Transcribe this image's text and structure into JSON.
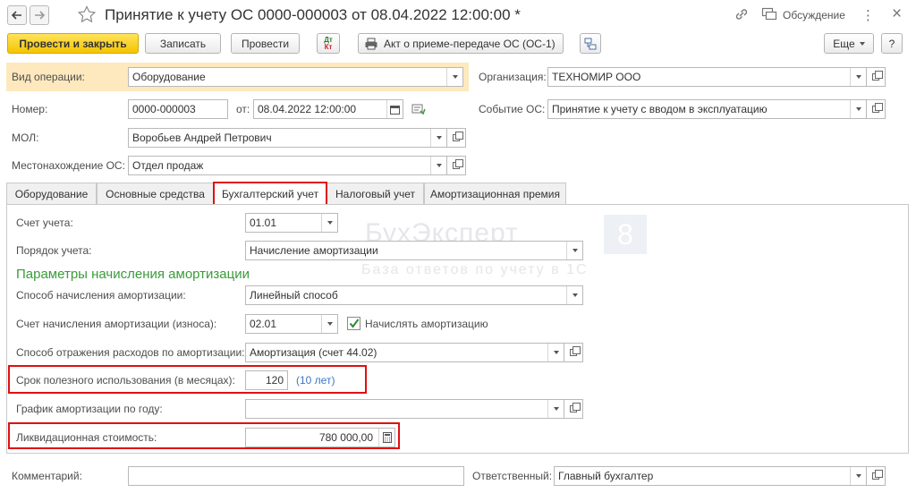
{
  "window": {
    "title": "Принятие к учету ОС 0000-000003 от 08.04.2022 12:00:00 *",
    "discussion_label": "Обсуждение",
    "more_glyph": "⋮",
    "close_glyph": "×"
  },
  "toolbar": {
    "post_close": "Провести и закрыть",
    "save": "Записать",
    "post": "Провести",
    "dt_kt_top": "Дт",
    "dt_kt_bottom": "Кт",
    "act_label": "Акт о приеме-передаче ОС (ОС-1)",
    "more": "Еще",
    "help": "?"
  },
  "header": {
    "operation_type_label": "Вид операции:",
    "operation_type_value": "Оборудование",
    "organization_label": "Организация:",
    "organization_value": "ТЕХНОМИР ООО",
    "number_label": "Номер:",
    "number_value": "0000-000003",
    "date_label": "от:",
    "date_value": "08.04.2022 12:00:00",
    "event_label": "Событие ОС:",
    "event_value": "Принятие к учету с вводом в эксплуатацию",
    "mol_label": "МОЛ:",
    "mol_value": "Воробьев Андрей Петрович",
    "location_label": "Местонахождение ОС:",
    "location_value": "Отдел продаж"
  },
  "tabs": [
    {
      "label": "Оборудование"
    },
    {
      "label": "Основные средства"
    },
    {
      "label": "Бухгалтерский учет"
    },
    {
      "label": "Налоговый учет"
    },
    {
      "label": "Амортизационная премия"
    }
  ],
  "accounting": {
    "account_label": "Счет учета:",
    "account_value": "01.01",
    "order_label": "Порядок учета:",
    "order_value": "Начисление амортизации",
    "section_title": "Параметры начисления амортизации",
    "method_label": "Способ начисления амортизации:",
    "method_value": "Линейный способ",
    "depr_account_label": "Счет начисления амортизации (износа):",
    "depr_account_value": "02.01",
    "accrue_label": "Начислять амортизацию",
    "accrue_checked": true,
    "expense_label": "Способ отражения расходов по амортизации:",
    "expense_value": "Амортизация (счет 44.02)",
    "useful_life_label": "Срок полезного использования (в месяцах):",
    "useful_life_value": "120",
    "useful_life_years": "(10 лет)",
    "schedule_label": "График амортизации по году:",
    "schedule_value": "",
    "liquidation_label": "Ликвидационная стоимость:",
    "liquidation_value": "780 000,00"
  },
  "watermark": {
    "title": "БухЭксперт",
    "badge": "8",
    "subtitle": "База ответов по учету в 1С"
  },
  "footer": {
    "comment_label": "Комментарий:",
    "comment_value": "",
    "responsible_label": "Ответственный:",
    "responsible_value": "Главный бухгалтер"
  },
  "colors": {
    "primary_button": "#f5c400",
    "highlight": "#e01010",
    "section_title": "#3a9b3a",
    "link": "#3b76c9",
    "operation_bg": "#fde9bd"
  }
}
